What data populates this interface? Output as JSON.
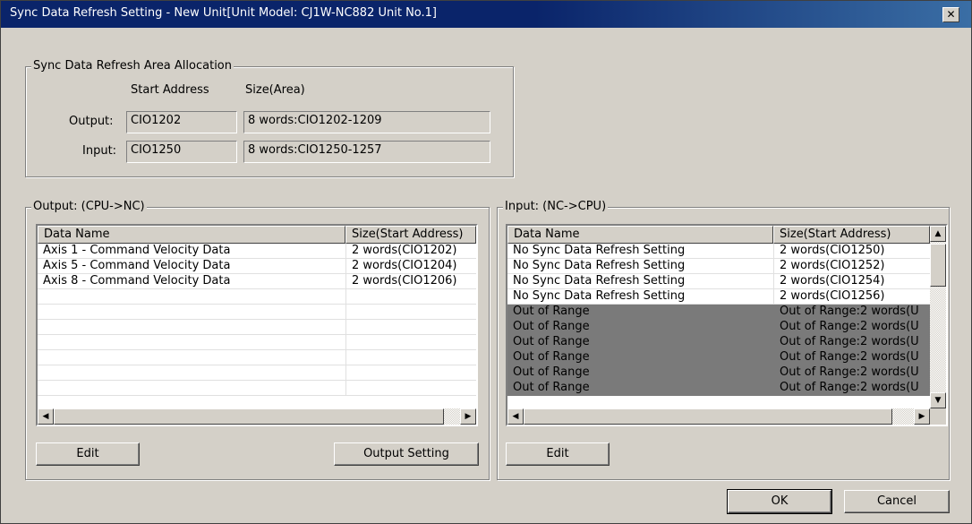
{
  "window": {
    "title": "Sync Data Refresh Setting - New Unit[Unit Model: CJ1W-NC882 Unit No.1]",
    "close_glyph": "✕"
  },
  "allocation": {
    "group_label": "Sync Data Refresh Area Allocation",
    "col_start": "Start Address",
    "col_size": "Size(Area)",
    "output_label": "Output:",
    "output_start": "CIO1202",
    "output_size": "8 words:CIO1202-1209",
    "input_label": "Input:",
    "input_start": "CIO1250",
    "input_size": "8 words:CIO1250-1257"
  },
  "output_panel": {
    "group_label": "Output: (CPU->NC)",
    "columns": [
      "Data Name",
      "Size(Start Address)"
    ],
    "rows": [
      [
        "Axis 1 - Command Velocity Data",
        "2 words(CIO1202)"
      ],
      [
        "Axis 5 - Command Velocity Data",
        "2 words(CIO1204)"
      ],
      [
        "Axis 8 - Command Velocity Data",
        "2 words(CIO1206)"
      ],
      [
        "",
        ""
      ],
      [
        "",
        ""
      ],
      [
        "",
        ""
      ],
      [
        "",
        ""
      ],
      [
        "",
        ""
      ],
      [
        "",
        ""
      ],
      [
        "",
        ""
      ]
    ],
    "edit_label": "Edit",
    "output_setting_label": "Output Setting"
  },
  "input_panel": {
    "group_label": "Input: (NC->CPU)",
    "columns": [
      "Data Name",
      "Size(Start Address)"
    ],
    "rows": [
      [
        "No Sync Data Refresh Setting",
        "2 words(CIO1250)"
      ],
      [
        "No Sync Data Refresh Setting",
        "2 words(CIO1252)"
      ],
      [
        "No Sync Data Refresh Setting",
        "2 words(CIO1254)"
      ],
      [
        "No Sync Data Refresh Setting",
        "2 words(CIO1256)"
      ],
      [
        "Out of Range",
        "Out of Range:2 words(U"
      ],
      [
        "Out of Range",
        "Out of Range:2 words(U"
      ],
      [
        "Out of Range",
        "Out of Range:2 words(U"
      ],
      [
        "Out of Range",
        "Out of Range:2 words(U"
      ],
      [
        "Out of Range",
        "Out of Range:2 words(U"
      ],
      [
        "Out of Range",
        "Out of Range:2 words(U"
      ]
    ],
    "selected_from_row": 4,
    "edit_label": "Edit"
  },
  "scroll": {
    "left_glyph": "◀",
    "right_glyph": "▶",
    "up_glyph": "▲",
    "down_glyph": "▼"
  },
  "footer": {
    "ok_label": "OK",
    "cancel_label": "Cancel"
  }
}
